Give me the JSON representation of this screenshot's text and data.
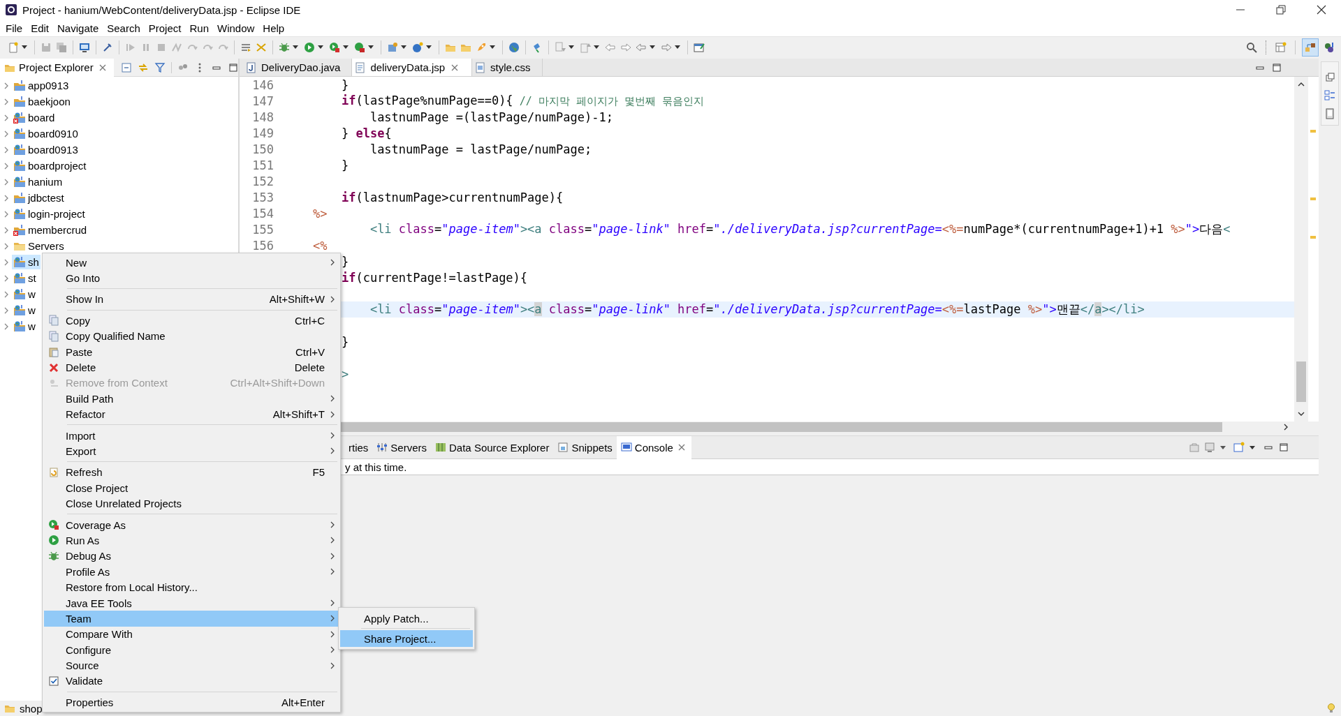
{
  "window": {
    "title": "Project - hanium/WebContent/deliveryData.jsp - Eclipse IDE"
  },
  "menu_bar": [
    "File",
    "Edit",
    "Navigate",
    "Search",
    "Project",
    "Run",
    "Window",
    "Help"
  ],
  "project_explorer": {
    "title": "Project Explorer",
    "items": [
      {
        "label": "app0913",
        "kind": "project",
        "error": false,
        "selected": false
      },
      {
        "label": "baekjoon",
        "kind": "project",
        "error": false,
        "selected": false
      },
      {
        "label": "board",
        "kind": "web-project",
        "error": true,
        "selected": false
      },
      {
        "label": "board0910",
        "kind": "web-project",
        "error": false,
        "selected": false
      },
      {
        "label": "board0913",
        "kind": "web-project",
        "error": false,
        "selected": false
      },
      {
        "label": "boardproject",
        "kind": "web-project",
        "error": false,
        "selected": false
      },
      {
        "label": "hanium",
        "kind": "web-project",
        "error": false,
        "selected": false
      },
      {
        "label": "jdbctest",
        "kind": "project",
        "error": false,
        "selected": false
      },
      {
        "label": "login-project",
        "kind": "web-project",
        "error": false,
        "selected": false
      },
      {
        "label": "membercrud",
        "kind": "project",
        "error": true,
        "selected": false
      },
      {
        "label": "Servers",
        "kind": "folder",
        "error": false,
        "selected": false
      },
      {
        "label": "sh",
        "kind": "web-project",
        "error": false,
        "selected": true
      },
      {
        "label": "st",
        "kind": "web-project",
        "error": false,
        "selected": false
      },
      {
        "label": "w",
        "kind": "web-project",
        "error": false,
        "selected": false
      },
      {
        "label": "w",
        "kind": "web-project",
        "error": false,
        "selected": false
      },
      {
        "label": "w",
        "kind": "web-project",
        "error": false,
        "selected": false
      }
    ]
  },
  "editor": {
    "tabs": [
      {
        "label": "DeliveryDao.java",
        "kind": "java",
        "selected": false
      },
      {
        "label": "deliveryData.jsp",
        "kind": "jsp",
        "selected": true
      },
      {
        "label": "style.css",
        "kind": "css",
        "selected": false
      }
    ],
    "lines": [
      {
        "number": "146",
        "current": false,
        "tokens": [
          {
            "kind": "plain",
            "text": "    }"
          }
        ]
      },
      {
        "number": "147",
        "current": false,
        "tokens": [
          {
            "kind": "keyword",
            "text": "    if"
          },
          {
            "kind": "plain",
            "text": "(lastPage%numPage==0){"
          },
          {
            "kind": "comment",
            "text": " // 마지막 페이지가 몇번째 묶음인지"
          }
        ]
      },
      {
        "number": "148",
        "current": false,
        "tokens": [
          {
            "kind": "plain",
            "text": "        lastnumPage =(lastPage/numPage)-1;"
          }
        ]
      },
      {
        "number": "149",
        "current": false,
        "tokens": [
          {
            "kind": "plain",
            "text": "    }"
          },
          {
            "kind": "keyword",
            "text": " else"
          },
          {
            "kind": "plain",
            "text": "{"
          }
        ]
      },
      {
        "number": "150",
        "current": false,
        "tokens": [
          {
            "kind": "plain",
            "text": "        lastnumPage = lastPage/numPage;"
          }
        ]
      },
      {
        "number": "151",
        "current": false,
        "tokens": [
          {
            "kind": "plain",
            "text": "    }"
          }
        ]
      },
      {
        "number": "152",
        "current": false
      },
      {
        "number": "153",
        "current": false,
        "tokens": [
          {
            "kind": "keyword",
            "text": "    if"
          },
          {
            "kind": "plain",
            "text": "(lastnumPage>currentnumPage){"
          }
        ]
      },
      {
        "number": "154",
        "current": false,
        "tokens": [
          {
            "kind": "jsp",
            "text": "%>"
          }
        ]
      },
      {
        "number": "155",
        "current": false,
        "tokens": [
          {
            "kind": "tag",
            "text": "        <li"
          },
          {
            "kind": "attr",
            "text": " class"
          },
          {
            "kind": "plain",
            "text": "="
          },
          {
            "kind": "value",
            "text": "\"page-item\""
          },
          {
            "kind": "tag",
            "text": "><a"
          },
          {
            "kind": "attr",
            "text": " class"
          },
          {
            "kind": "plain",
            "text": "="
          },
          {
            "kind": "value",
            "text": "\"page-link\""
          },
          {
            "kind": "attr",
            "text": " href"
          },
          {
            "kind": "plain",
            "text": "="
          },
          {
            "kind": "value",
            "text": "\"./deliveryData.jsp?currentPage="
          },
          {
            "kind": "jsp",
            "text": "<%="
          },
          {
            "kind": "plain",
            "text": "numPage*(currentnumPage+1)+1"
          },
          {
            "kind": "jsp",
            "text": " %>"
          },
          {
            "kind": "value",
            "text": "\">"
          },
          {
            "kind": "plain",
            "text": "다음"
          },
          {
            "kind": "tag",
            "text": "<"
          }
        ]
      },
      {
        "number": "156",
        "current": false,
        "tokens": [
          {
            "kind": "jsp",
            "text": "<%"
          }
        ]
      },
      {
        "current": false,
        "tokens": [
          {
            "kind": "plain",
            "text": "    }"
          }
        ]
      },
      {
        "current": false,
        "tokens": [
          {
            "kind": "keyword",
            "text": "    if"
          },
          {
            "kind": "plain",
            "text": "(currentPage!=lastPage){"
          }
        ]
      },
      {
        "current": false
      },
      {
        "current": true,
        "tokens": [
          {
            "kind": "tag",
            "text": "        <li"
          },
          {
            "kind": "attr",
            "text": " class"
          },
          {
            "kind": "plain",
            "text": "="
          },
          {
            "kind": "value",
            "text": "\"page-item\""
          },
          {
            "kind": "tag",
            "text": "><"
          },
          {
            "kind": "match",
            "text": "a"
          },
          {
            "kind": "attr",
            "text": " class"
          },
          {
            "kind": "plain",
            "text": "="
          },
          {
            "kind": "value",
            "text": "\"page-link\""
          },
          {
            "kind": "attr",
            "text": " href"
          },
          {
            "kind": "plain",
            "text": "="
          },
          {
            "kind": "value",
            "text": "\"./deliveryData.jsp?currentPage="
          },
          {
            "kind": "jsp",
            "text": "<%="
          },
          {
            "kind": "plain",
            "text": "lastPage"
          },
          {
            "kind": "jsp",
            "text": " %>"
          },
          {
            "kind": "value",
            "text": "\">"
          },
          {
            "kind": "plain",
            "text": "맨끝"
          },
          {
            "kind": "tag",
            "text": "</"
          },
          {
            "kind": "match",
            "text": "a"
          },
          {
            "kind": "tag",
            "text": "></li>"
          }
        ]
      },
      {
        "current": false
      },
      {
        "current": false,
        "tokens": [
          {
            "kind": "plain",
            "text": "    }"
          }
        ]
      },
      {
        "current": false
      },
      {
        "current": false,
        "tokens": [
          {
            "kind": "tag",
            "text": "    >"
          }
        ]
      }
    ]
  },
  "bottom_panel": {
    "tabs": [
      {
        "label": "rties",
        "kind": "none",
        "selected": false
      },
      {
        "label": "Servers",
        "kind": "servers",
        "selected": false
      },
      {
        "label": "Data Source Explorer",
        "kind": "datasource",
        "selected": false
      },
      {
        "label": "Snippets",
        "kind": "snippets",
        "selected": false
      },
      {
        "label": "Console",
        "kind": "console",
        "selected": true
      }
    ],
    "console_text": "y at this time."
  },
  "context_menu": {
    "items": [
      {
        "kind": "item",
        "label": "New",
        "submenu": true,
        "disabled": false,
        "selected": false,
        "checked": false
      },
      {
        "kind": "item",
        "label": "Go Into",
        "submenu": false,
        "disabled": false,
        "selected": false,
        "checked": false
      },
      {
        "kind": "separator"
      },
      {
        "kind": "item",
        "label": "Show In",
        "shortcut": "Alt+Shift+W",
        "submenu": true,
        "disabled": false,
        "selected": false,
        "checked": false
      },
      {
        "kind": "separator"
      },
      {
        "kind": "copy",
        "label": "Copy",
        "shortcut": "Ctrl+C",
        "submenu": false,
        "disabled": false,
        "selected": false,
        "checked": false
      },
      {
        "kind": "copy",
        "label": "Copy Qualified Name",
        "submenu": false,
        "disabled": false,
        "selected": false,
        "checked": false
      },
      {
        "kind": "paste",
        "label": "Paste",
        "shortcut": "Ctrl+V",
        "submenu": false,
        "disabled": false,
        "selected": false,
        "checked": false
      },
      {
        "kind": "delete",
        "label": "Delete",
        "shortcut": "Delete",
        "submenu": false,
        "disabled": false,
        "selected": false,
        "checked": false
      },
      {
        "kind": "remove",
        "label": "Remove from Context",
        "shortcut": "Ctrl+Alt+Shift+Down",
        "submenu": false,
        "disabled": true,
        "selected": false,
        "checked": false
      },
      {
        "kind": "item",
        "label": "Build Path",
        "submenu": true,
        "disabled": false,
        "selected": false,
        "checked": false
      },
      {
        "kind": "item",
        "label": "Refactor",
        "shortcut": "Alt+Shift+T",
        "submenu": true,
        "disabled": false,
        "selected": false,
        "checked": false
      },
      {
        "kind": "separator"
      },
      {
        "kind": "item",
        "label": "Import",
        "submenu": true,
        "disabled": false,
        "selected": false,
        "checked": false
      },
      {
        "kind": "item",
        "label": "Export",
        "submenu": true,
        "disabled": false,
        "selected": false,
        "checked": false
      },
      {
        "kind": "separator"
      },
      {
        "kind": "refresh",
        "label": "Refresh",
        "shortcut": "F5",
        "submenu": false,
        "disabled": false,
        "selected": false,
        "checked": false
      },
      {
        "kind": "item",
        "label": "Close Project",
        "submenu": false,
        "disabled": false,
        "selected": false,
        "checked": false
      },
      {
        "kind": "item",
        "label": "Close Unrelated Projects",
        "submenu": false,
        "disabled": false,
        "selected": false,
        "checked": false
      },
      {
        "kind": "separator"
      },
      {
        "kind": "coverage",
        "label": "Coverage As",
        "submenu": true,
        "disabled": false,
        "selected": false,
        "checked": false
      },
      {
        "kind": "run",
        "label": "Run As",
        "submenu": true,
        "disabled": false,
        "selected": false,
        "checked": false
      },
      {
        "kind": "debug",
        "label": "Debug As",
        "submenu": true,
        "disabled": false,
        "selected": false,
        "checked": false
      },
      {
        "kind": "item",
        "label": "Profile As",
        "submenu": true,
        "disabled": false,
        "selected": false,
        "checked": false
      },
      {
        "kind": "item",
        "label": "Restore from Local History...",
        "submenu": false,
        "disabled": false,
        "selected": false,
        "checked": false
      },
      {
        "kind": "item",
        "label": "Java EE Tools",
        "submenu": true,
        "disabled": false,
        "selected": false,
        "checked": false
      },
      {
        "kind": "item",
        "label": "Team",
        "submenu": true,
        "disabled": false,
        "selected": true,
        "checked": false
      },
      {
        "kind": "item",
        "label": "Compare With",
        "submenu": true,
        "disabled": false,
        "selected": false,
        "checked": false
      },
      {
        "kind": "item",
        "label": "Configure",
        "submenu": true,
        "disabled": false,
        "selected": false,
        "checked": false
      },
      {
        "kind": "item",
        "label": "Source",
        "submenu": true,
        "disabled": false,
        "selected": false,
        "checked": false
      },
      {
        "kind": "item",
        "label": "Validate",
        "submenu": false,
        "disabled": false,
        "selected": false,
        "checked": true
      },
      {
        "kind": "separator"
      },
      {
        "kind": "item",
        "label": "Properties",
        "shortcut": "Alt+Enter",
        "submenu": false,
        "disabled": false,
        "selected": false,
        "checked": false
      }
    ]
  },
  "submenu": {
    "items": [
      {
        "label": "Apply Patch...",
        "selected": false
      },
      {
        "label": "Share Project...",
        "selected": true
      }
    ]
  },
  "status_bar": {
    "text": "shop"
  }
}
